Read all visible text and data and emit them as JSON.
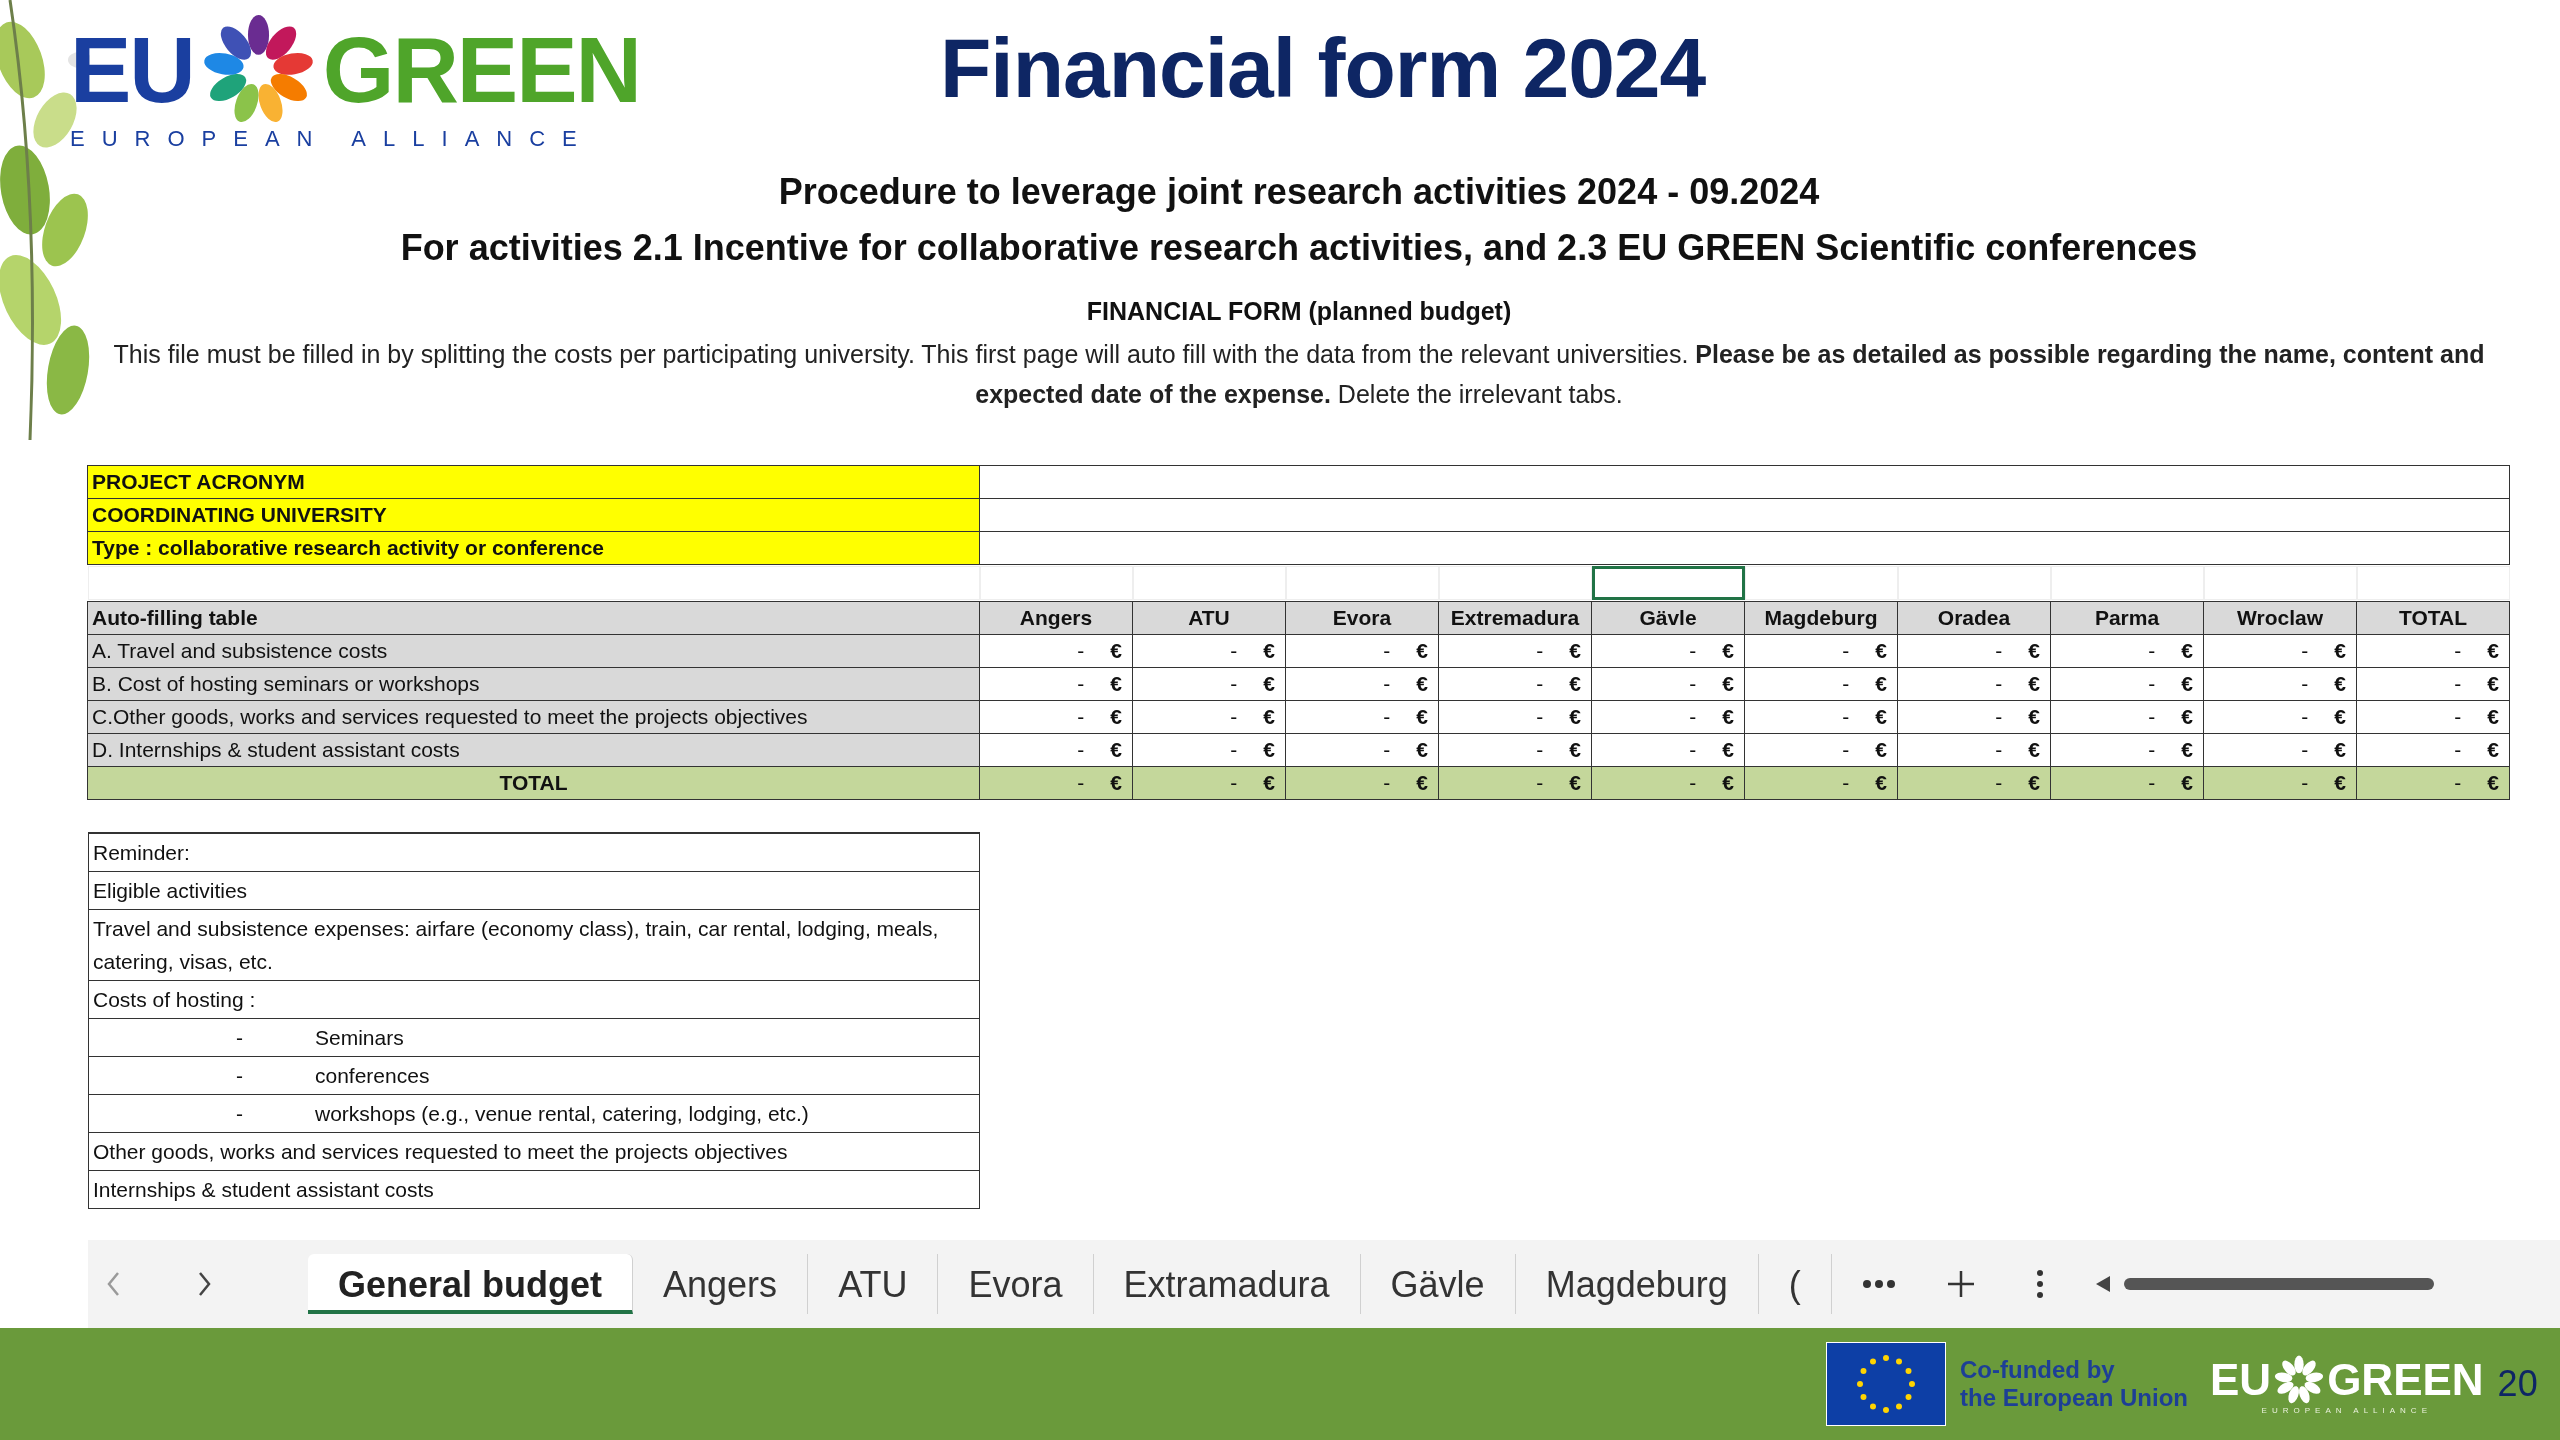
{
  "header": {
    "logo": {
      "left": "EU",
      "right": "GREEN",
      "tagline": "EUROPEAN ALLIANCE"
    },
    "title": "Financial form 2024"
  },
  "sheet": {
    "headings": [
      "Procedure to leverage joint research activities 2024  - 09.2024",
      "For activities 2.1 Incentive for collaborative research activities, and 2.3 EU GREEN Scientific conferences"
    ],
    "form_title": "FINANCIAL FORM (planned budget)",
    "instructions": "This file must be filled in by splitting the costs per participating university. This first page will auto fill with the data from the relevant universities. **Please be as detailed as possible regarding the name, content and expected date of the expense.** Delete the irrelevant tabs.",
    "info_rows": [
      {
        "label": "PROJECT ACRONYM"
      },
      {
        "label": "COORDINATING UNIVERSITY"
      },
      {
        "label": "Type : collaborative research activity or conference"
      }
    ],
    "active_row": [
      {
        "selected": false
      },
      {
        "selected": false
      },
      {
        "selected": false
      },
      {
        "selected": false
      },
      {
        "selected": true
      },
      {
        "selected": false
      },
      {
        "selected": false
      },
      {
        "selected": false
      },
      {
        "selected": false
      },
      {
        "selected": false
      }
    ],
    "table": {
      "header_label": "Auto-filling table",
      "columns": [
        "Angers",
        "ATU",
        "Evora",
        "Extremadura",
        "Gävle",
        "Magdeburg",
        "Oradea",
        "Parma",
        "Wroclaw",
        "TOTAL"
      ],
      "rows": [
        {
          "kind": "item",
          "label": "A. Travel and subsistence costs",
          "cells": [
            {
              "amount": "-",
              "currency": "€"
            },
            {
              "amount": "-",
              "currency": "€"
            },
            {
              "amount": "-",
              "currency": "€"
            },
            {
              "amount": "-",
              "currency": "€"
            },
            {
              "amount": "-",
              "currency": "€"
            },
            {
              "amount": "-",
              "currency": "€"
            },
            {
              "amount": "-",
              "currency": "€"
            },
            {
              "amount": "-",
              "currency": "€"
            },
            {
              "amount": "-",
              "currency": "€"
            },
            {
              "amount": "-",
              "currency": "€"
            }
          ]
        },
        {
          "kind": "item",
          "label": "B. Cost of hosting seminars or workshops",
          "cells": [
            {
              "amount": "-",
              "currency": "€"
            },
            {
              "amount": "-",
              "currency": "€"
            },
            {
              "amount": "-",
              "currency": "€"
            },
            {
              "amount": "-",
              "currency": "€"
            },
            {
              "amount": "-",
              "currency": "€"
            },
            {
              "amount": "-",
              "currency": "€"
            },
            {
              "amount": "-",
              "currency": "€"
            },
            {
              "amount": "-",
              "currency": "€"
            },
            {
              "amount": "-",
              "currency": "€"
            },
            {
              "amount": "-",
              "currency": "€"
            }
          ]
        },
        {
          "kind": "item",
          "label": "C.Other goods, works and services requested to meet the projects objectives",
          "cells": [
            {
              "amount": "-",
              "currency": "€"
            },
            {
              "amount": "-",
              "currency": "€"
            },
            {
              "amount": "-",
              "currency": "€"
            },
            {
              "amount": "-",
              "currency": "€"
            },
            {
              "amount": "-",
              "currency": "€"
            },
            {
              "amount": "-",
              "currency": "€"
            },
            {
              "amount": "-",
              "currency": "€"
            },
            {
              "amount": "-",
              "currency": "€"
            },
            {
              "amount": "-",
              "currency": "€"
            },
            {
              "amount": "-",
              "currency": "€"
            }
          ]
        },
        {
          "kind": "item",
          "label": "D. Internships & student assistant costs",
          "cells": [
            {
              "amount": "-",
              "currency": "€"
            },
            {
              "amount": "-",
              "currency": "€"
            },
            {
              "amount": "-",
              "currency": "€"
            },
            {
              "amount": "-",
              "currency": "€"
            },
            {
              "amount": "-",
              "currency": "€"
            },
            {
              "amount": "-",
              "currency": "€"
            },
            {
              "amount": "-",
              "currency": "€"
            },
            {
              "amount": "-",
              "currency": "€"
            },
            {
              "amount": "-",
              "currency": "€"
            },
            {
              "amount": "-",
              "currency": "€"
            }
          ]
        },
        {
          "kind": "total",
          "label": "TOTAL",
          "cells": [
            {
              "amount": "-",
              "currency": "€"
            },
            {
              "amount": "-",
              "currency": "€"
            },
            {
              "amount": "-",
              "currency": "€"
            },
            {
              "amount": "-",
              "currency": "€"
            },
            {
              "amount": "-",
              "currency": "€"
            },
            {
              "amount": "-",
              "currency": "€"
            },
            {
              "amount": "-",
              "currency": "€"
            },
            {
              "amount": "-",
              "currency": "€"
            },
            {
              "amount": "-",
              "currency": "€"
            },
            {
              "amount": "-",
              "currency": "€"
            }
          ]
        }
      ]
    },
    "reminder": [
      {
        "kind": "text",
        "text": "Reminder:"
      },
      {
        "kind": "text",
        "text": "Eligible activities"
      },
      {
        "kind": "text",
        "text": "Travel and subsistence expenses: airfare (economy class), train, car rental, lodging, meals, catering, visas, etc."
      },
      {
        "kind": "text",
        "text": "Costs of hosting :"
      },
      {
        "kind": "bullet",
        "bullet": "-",
        "text": "Seminars"
      },
      {
        "kind": "bullet",
        "bullet": "-",
        "text": "conferences"
      },
      {
        "kind": "bullet",
        "bullet": "-",
        "text": "workshops (e.g., venue rental, catering, lodging, etc.)"
      },
      {
        "kind": "text",
        "text": "Other goods, works and services requested to meet the projects objectives"
      },
      {
        "kind": "text",
        "text": "Internships & student assistant costs"
      }
    ]
  },
  "sheet_tabs": [
    {
      "label": "General budget",
      "selected": true
    },
    {
      "label": "Angers",
      "selected": false
    },
    {
      "label": "ATU",
      "selected": false
    },
    {
      "label": "Evora",
      "selected": false
    },
    {
      "label": "Extramadura",
      "selected": false
    },
    {
      "label": "Gävle",
      "selected": false
    },
    {
      "label": "Magdeburg",
      "selected": false
    },
    {
      "label": "(",
      "selected": false
    }
  ],
  "footer": {
    "funding_lines": [
      "Co-funded by",
      "the European Union"
    ],
    "logo": {
      "left": "EU",
      "right": "GREEN",
      "tagline": "EUROPEAN ALLIANCE"
    },
    "page": "20"
  }
}
